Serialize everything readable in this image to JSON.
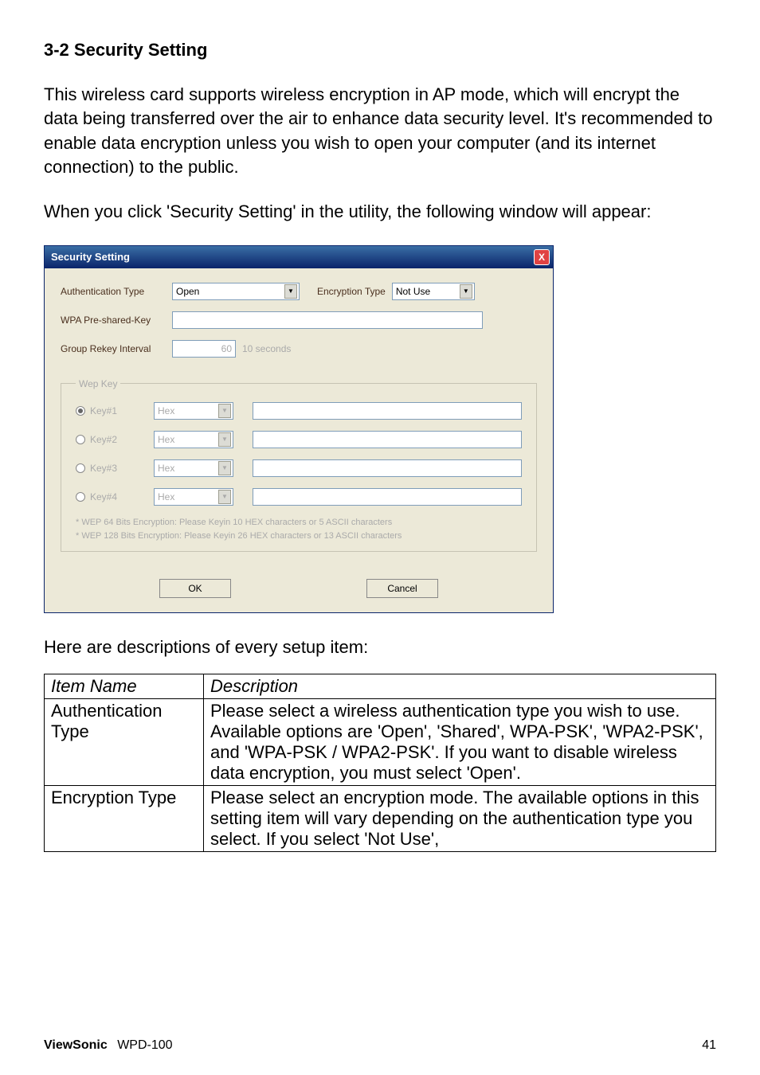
{
  "heading": "3-2 Security Setting",
  "para1": "This wireless card supports wireless encryption in AP mode, which will encrypt the data being transferred over the air to enhance data security level. It's recommended to enable data encryption unless you wish to open your computer (and its internet connection) to the public.",
  "para2": "When you click 'Security Setting' in the utility, the following window will appear:",
  "dialog": {
    "title": "Security Setting",
    "close": "X",
    "auth_label": "Authentication Type",
    "auth_value": "Open",
    "enc_label": "Encryption Type",
    "enc_value": "Not Use",
    "psk_label": "WPA Pre-shared-Key",
    "rekey_label": "Group Rekey Interval",
    "rekey_value": "60",
    "rekey_unit": "10 seconds",
    "wep_legend": "Wep Key",
    "keys": [
      {
        "label": "Key#1",
        "fmt": "Hex"
      },
      {
        "label": "Key#2",
        "fmt": "Hex"
      },
      {
        "label": "Key#3",
        "fmt": "Hex"
      },
      {
        "label": "Key#4",
        "fmt": "Hex"
      }
    ],
    "hint1": "* WEP   64 Bits Encryption:  Please Keyin 10 HEX characters or   5 ASCII characters",
    "hint2": "* WEP 128 Bits Encryption:  Please Keyin 26 HEX characters or 13 ASCII characters",
    "ok": "OK",
    "cancel": "Cancel"
  },
  "sub_heading": "Here are descriptions of every setup item:",
  "table": {
    "h1": "Item Name",
    "h2": "Description",
    "r1c1": "Authentication Type",
    "r1c2": "Please select a wireless authentication type you wish to use. Available options are 'Open', 'Shared', WPA-PSK', 'WPA2-PSK', and 'WPA-PSK / WPA2-PSK'. If you want to disable wireless data encryption, you must select 'Open'.",
    "r2c1": "Encryption Type",
    "r2c2": "Please select an encryption mode. The available options in this setting item will vary depending on the authentication type you select. If you select 'Not Use',"
  },
  "footer": {
    "brand": "ViewSonic",
    "model": "WPD-100",
    "page": "41"
  }
}
